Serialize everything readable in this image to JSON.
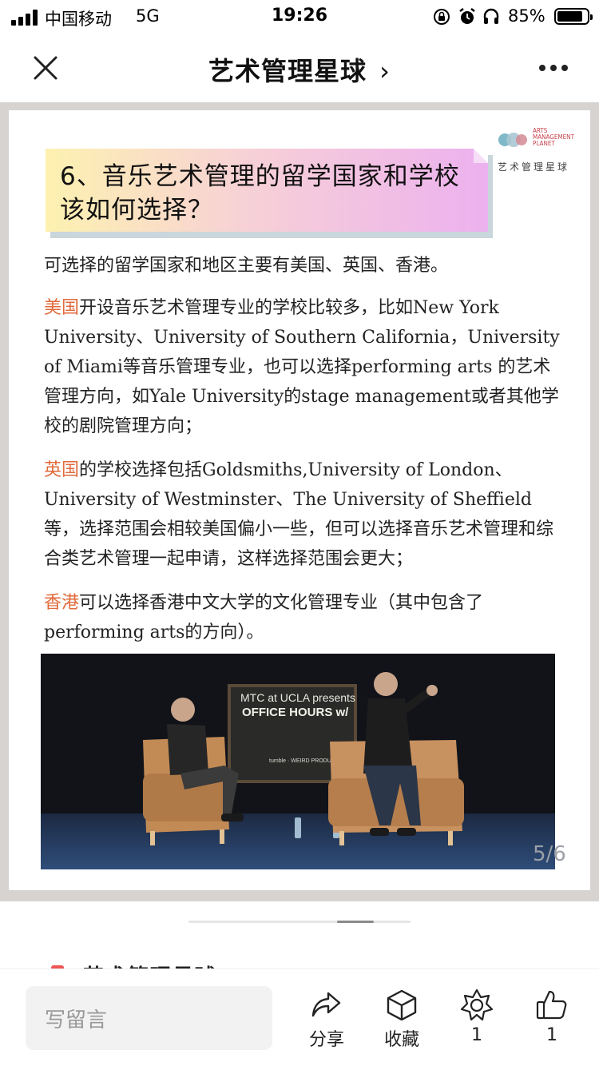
{
  "status_bar": {
    "carrier": "中国移动",
    "network": "5G",
    "time": "19:26",
    "battery": "85%",
    "battery_level": 0.85
  },
  "nav": {
    "title": "艺术管理星球",
    "title_chevron": "›"
  },
  "logo": {
    "en_lines": [
      "ARTS",
      "MANAGEMENT",
      "PLANET"
    ],
    "cn": "艺术管理星球"
  },
  "article": {
    "heading_line1": "6、音乐艺术管理的留学国家和学校",
    "heading_line2": "该如何选择？",
    "intro": "可选择的留学国家和地区主要有美国、英国、香港。",
    "us_label": "美国",
    "us_text": "开设音乐艺术管理专业的学校比较多，比如New York University、University of Southern California，University of Miami等音乐管理专业，也可以选择performing arts 的艺术管理方向，如Yale University的stage management或者其他学校的剧院管理方向；",
    "uk_label": "英国",
    "uk_text": "的学校选择包括Goldsmiths,University of London、University of Westminster、The University of Sheffield等，选择范围会相较美国偏小一些，但可以选择音乐艺术管理和综合类艺术管理一起申请，这样选择范围会更大；",
    "hk_label": "香港",
    "hk_text": "可以选择香港中文大学的文化管理专业（其中包含了performing arts的方向）。",
    "photo_board": {
      "line1": "MTC at UCLA presents",
      "line2": "OFFICE HOURS w/",
      "line3": "tumble · WEIRD PRODUCTIONS"
    },
    "page_indicator": "5/6"
  },
  "peek_title": "艺术管理星球",
  "bottom_bar": {
    "comment_placeholder": "写留言",
    "share_label": "分享",
    "favorite_label": "收藏",
    "wow_count": "1",
    "like_count": "1"
  }
}
